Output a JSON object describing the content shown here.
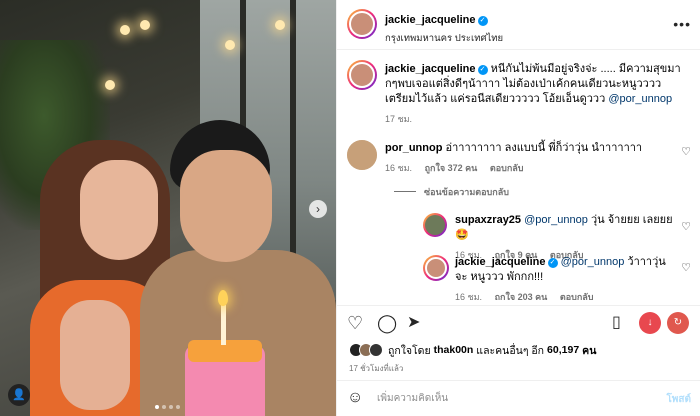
{
  "header": {
    "username": "jackie_jacqueline",
    "location": "กรุงเทพมหานคร ประเทศไทย",
    "more": "•••"
  },
  "caption": {
    "username": "jackie_jacqueline",
    "text": "หนีกันไม่พ้นมีอยู่จริงจ่ะ ..... มีความสุขมากๆพบเจอแต่สิ่งดีๆน้าาาา ไม่ต้องเป่าเค้กคนเดียวนะหนูวววว เตรียมไว้แล้ว แค่รอนีสเดียววววว โอ้ยเอ็นดูววว",
    "mention": "@por_unnop",
    "time": "17 ชม."
  },
  "comments": [
    {
      "username": "por_unnop",
      "text": "อ่าาาาาาาา ลงแบบนี้ พี่ก็ว่าวุ่น นำาาาาาา",
      "time": "16 ชม.",
      "likes": "ถูกใจ 372 คน",
      "reply": "ตอบกลับ"
    },
    {
      "username": "supaxzray25",
      "mention": "@por_unnop",
      "text": "วุ่น จ้ายยย เลยยย🤩",
      "time": "16 ชม.",
      "likes": "ถูกใจ 9 คน",
      "reply": "ตอบกลับ"
    },
    {
      "username": "jackie_jacqueline",
      "mention": "@por_unnop",
      "text": "ว้าาาวุ่นจะ หนูววว พักกก!!!",
      "time": "16 ชม.",
      "likes": "ถูกใจ 203 คน",
      "reply": "ตอบกลับ"
    }
  ],
  "hide_replies": "ซ่อนข้อความตอบกลับ",
  "likes": {
    "prefix": "ถูกใจโดย",
    "user": "thak00n",
    "middle": "และคนอื่นๆ อีก",
    "count": "60,197",
    "suffix": "คน"
  },
  "post_time": "17 ชั่วโมงที่แล้ว",
  "add_comment": {
    "placeholder": "เพิ่มความคิดเห็น",
    "post": "โพสต์"
  },
  "icons": {
    "heart": "heart-icon",
    "comment": "comment-icon",
    "share": "share-icon",
    "save": "bookmark-icon",
    "emoji": "emoji-icon"
  },
  "colors": {
    "verified": "#0095f6",
    "mention": "#00376b",
    "meta": "#737373",
    "post_disabled": "#b2dffc"
  }
}
